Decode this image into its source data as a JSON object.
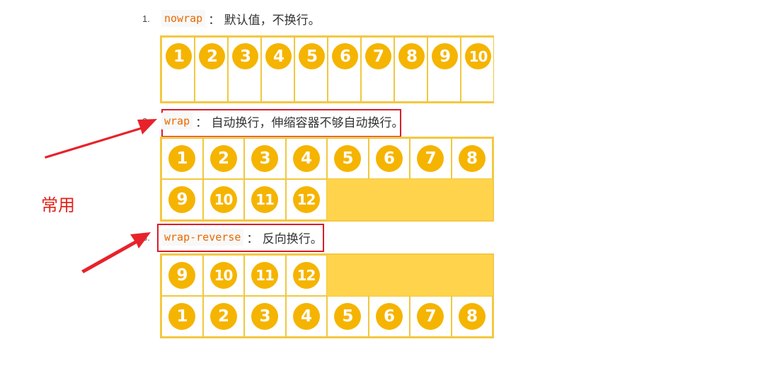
{
  "items": [
    {
      "num": "1.",
      "code": "nowrap",
      "desc": "： 默认值，不换行。"
    },
    {
      "num": "2.",
      "code": "wrap",
      "desc": "： 自动换行，伸缩容器不够自动换行。"
    },
    {
      "num": "3.",
      "code": "wrap-reverse",
      "desc": "： 反向换行。"
    }
  ],
  "demo_nowrap": [
    "1",
    "2",
    "3",
    "4",
    "5",
    "6",
    "7",
    "8",
    "9",
    "10"
  ],
  "demo_wrap": [
    "1",
    "2",
    "3",
    "4",
    "5",
    "6",
    "7",
    "8",
    "9",
    "10",
    "11",
    "12"
  ],
  "demo_wrap_reverse": [
    "9",
    "10",
    "11",
    "12",
    "1",
    "2",
    "3",
    "4",
    "5",
    "6",
    "7",
    "8"
  ],
  "annotation": "常用",
  "colors": {
    "circle": "#f5b400",
    "container": "#ffd44c",
    "code": "#e96900",
    "highlight": "#d81e2a"
  }
}
